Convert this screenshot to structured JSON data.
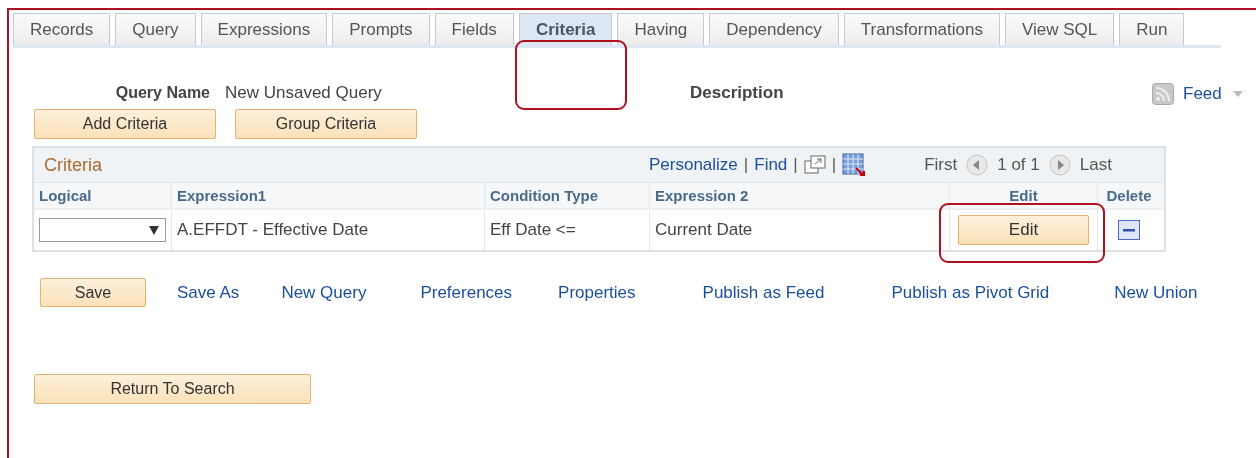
{
  "tabs": [
    {
      "label": "Records",
      "selected": false,
      "highlighted": false
    },
    {
      "label": "Query",
      "selected": false,
      "highlighted": false
    },
    {
      "label": "Expressions",
      "selected": false,
      "highlighted": false
    },
    {
      "label": "Prompts",
      "selected": false,
      "highlighted": false
    },
    {
      "label": "Fields",
      "selected": false,
      "highlighted": false
    },
    {
      "label": "Criteria",
      "selected": true,
      "highlighted": true
    },
    {
      "label": "Having",
      "selected": false,
      "highlighted": false
    },
    {
      "label": "Dependency",
      "selected": false,
      "highlighted": false
    },
    {
      "label": "Transformations",
      "selected": false,
      "highlighted": false
    },
    {
      "label": "View SQL",
      "selected": false,
      "highlighted": false
    },
    {
      "label": "Run",
      "selected": false,
      "highlighted": false
    }
  ],
  "query_name": {
    "label": "Query Name",
    "value": "New Unsaved Query"
  },
  "description": {
    "label": "Description"
  },
  "feed": {
    "label": "Feed"
  },
  "criteria_buttons": [
    "Add Criteria",
    "Group Criteria"
  ],
  "grid": {
    "title": "Criteria",
    "toolbar": [
      {
        "kind": "link",
        "text": "Personalize"
      },
      {
        "kind": "separator",
        "text": "|"
      },
      {
        "kind": "link",
        "text": "Find"
      },
      {
        "kind": "separator",
        "text": "|"
      },
      {
        "kind": "popout"
      },
      {
        "kind": "separator",
        "text": "|"
      },
      {
        "kind": "spreadsheet"
      }
    ],
    "nav": {
      "first": "First",
      "count": "1 of 1",
      "last": "Last"
    },
    "columns": [
      "Logical",
      "Expression1",
      "Condition Type",
      "Expression 2",
      "Edit",
      "Delete"
    ],
    "rows": [
      {
        "expression1": "A.EFFDT - Effective Date",
        "condition_type": "Eff Date <=",
        "expression2": "Current Date",
        "edit": "Edit",
        "edit_highlighted": true
      }
    ]
  },
  "actions": [
    {
      "kind": "button",
      "label": "Save"
    },
    {
      "kind": "link",
      "label": "Save As"
    },
    {
      "kind": "link",
      "label": "New Query"
    },
    {
      "kind": "link",
      "label": "Preferences"
    },
    {
      "kind": "link",
      "label": "Properties"
    },
    {
      "kind": "link",
      "label": "Publish as Feed"
    },
    {
      "kind": "link",
      "label": "Publish as Pivot Grid"
    },
    {
      "kind": "link",
      "label": "New Union"
    }
  ],
  "return_button": "Return To Search"
}
